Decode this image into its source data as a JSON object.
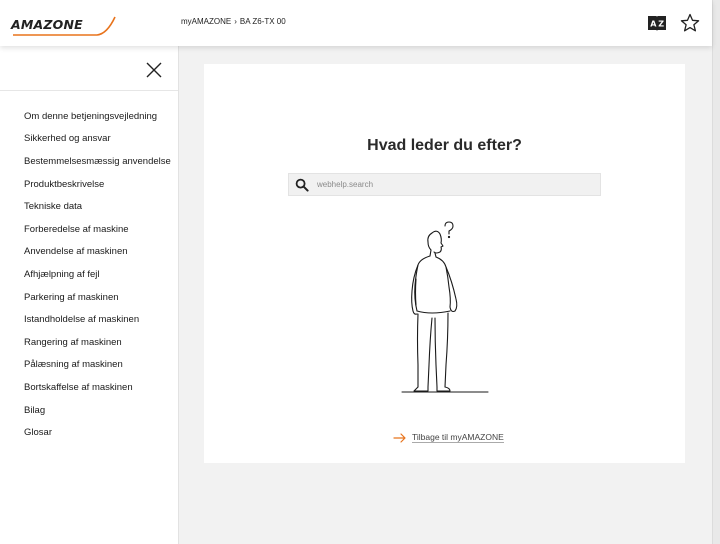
{
  "header": {
    "logo_text": "AMAZONE",
    "breadcrumb": [
      "myAMAZONE",
      "BA Z6-TX 00"
    ],
    "breadcrumb_sep": "›",
    "icons": [
      "glossary-book-icon",
      "favorite-star-icon"
    ]
  },
  "sidebar": {
    "close_icon": "close-icon",
    "items": [
      {
        "label": "Om denne betjeningsvejledning"
      },
      {
        "label": "Sikkerhed og ansvar"
      },
      {
        "label": "Bestemmelsesmæssig anvendelse"
      },
      {
        "label": "Produktbeskrivelse"
      },
      {
        "label": "Tekniske data"
      },
      {
        "label": "Forberedelse af maskine"
      },
      {
        "label": "Anvendelse af maskinen"
      },
      {
        "label": "Afhjælpning af fejl"
      },
      {
        "label": "Parkering af maskinen"
      },
      {
        "label": "Istandholdelse af maskinen"
      },
      {
        "label": "Rangering af maskinen"
      },
      {
        "label": "Pålæsning af maskinen"
      },
      {
        "label": "Bortskaffelse af maskinen"
      },
      {
        "label": "Bilag"
      },
      {
        "label": "Glosar"
      }
    ]
  },
  "main": {
    "title": "Hvad leder du efter?",
    "search": {
      "placeholder": "webhelp.search",
      "value": ""
    },
    "back_link": "Tilbage til myAMAZONE",
    "colors": {
      "accent": "#e8731c",
      "text": "#2a2a2a"
    }
  }
}
